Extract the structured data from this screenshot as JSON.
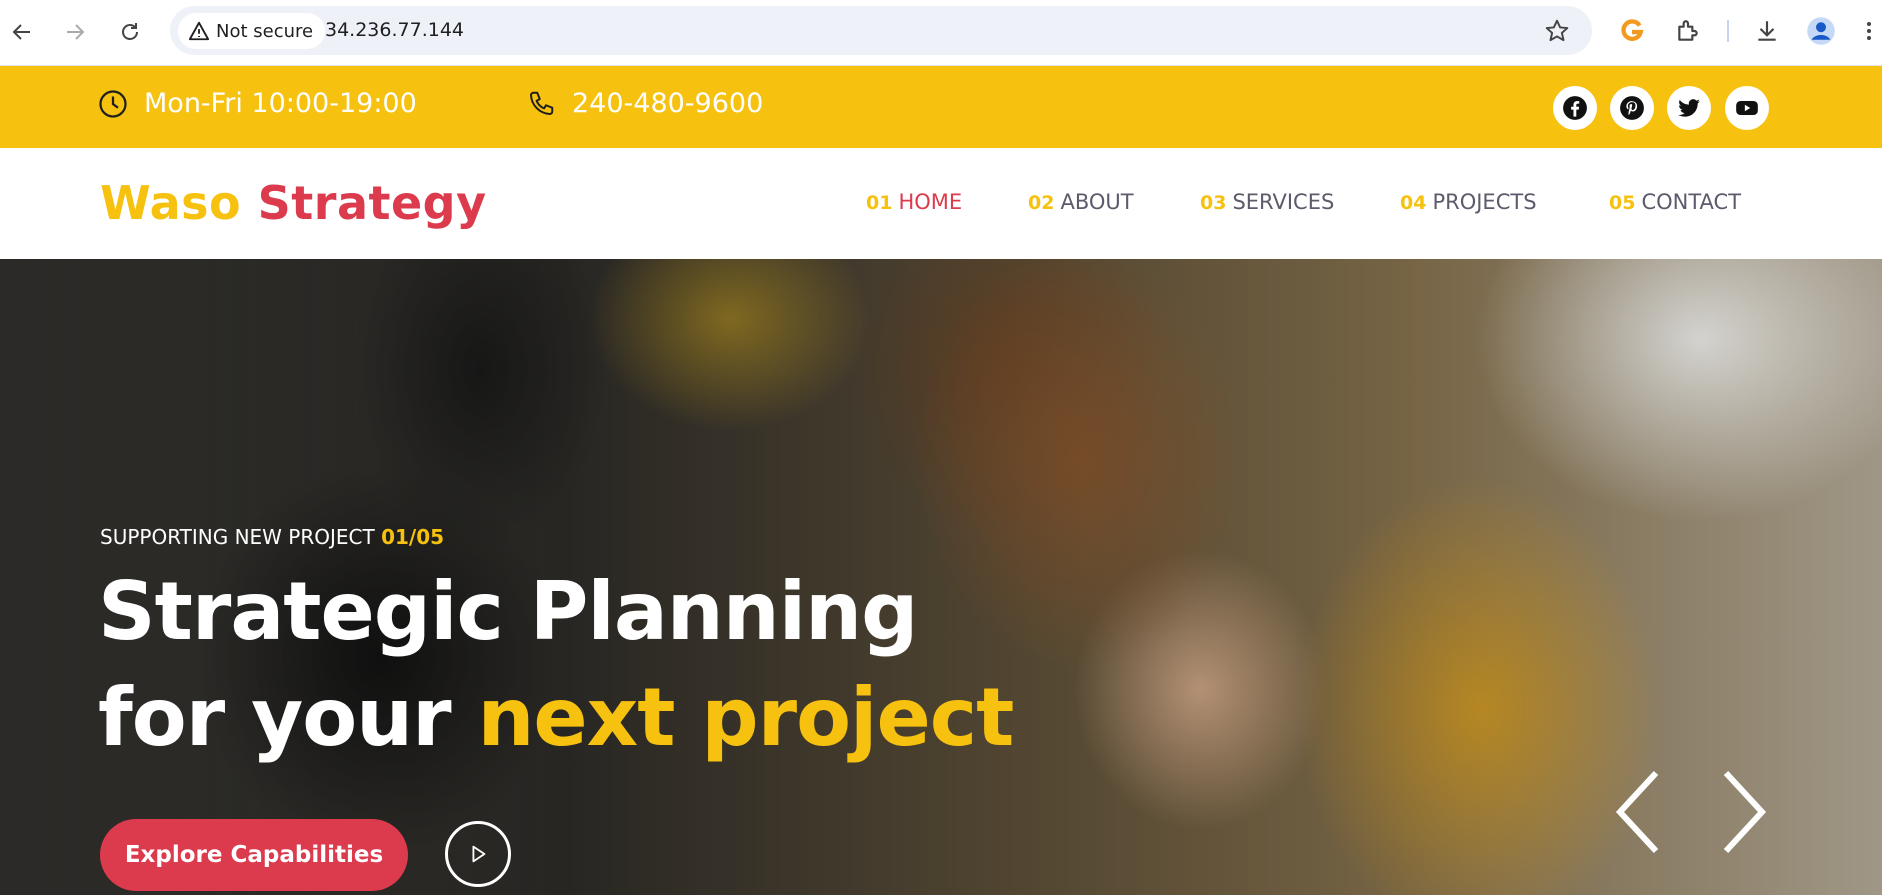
{
  "browser": {
    "security_label": "Not secure",
    "url": "34.236.77.144"
  },
  "topbar": {
    "hours": "Mon-Fri 10:00-19:00",
    "phone": "240-480-9600",
    "social_icons": [
      "facebook-icon",
      "pinterest-icon",
      "twitter-icon",
      "youtube-icon"
    ]
  },
  "header": {
    "logo_part1": "Waso",
    "logo_part2": "Strategy",
    "nav": [
      {
        "num": "01",
        "label": "HOME",
        "active": true
      },
      {
        "num": "02",
        "label": "ABOUT"
      },
      {
        "num": "03",
        "label": "SERVICES"
      },
      {
        "num": "04",
        "label": "PROJECTS"
      },
      {
        "num": "05",
        "label": "CONTACT"
      }
    ]
  },
  "hero": {
    "eyebrow": "SUPPORTING NEW PROJECT",
    "counter": "01/05",
    "title_line1": "Strategic Planning",
    "title_line2_white": "for your",
    "title_line2_highlight": "next project",
    "cta_label": "Explore Capabilities"
  },
  "colors": {
    "accent_yellow": "#f6c10f",
    "accent_red": "#dc3a4d",
    "nav_text": "#5b5b6b"
  }
}
